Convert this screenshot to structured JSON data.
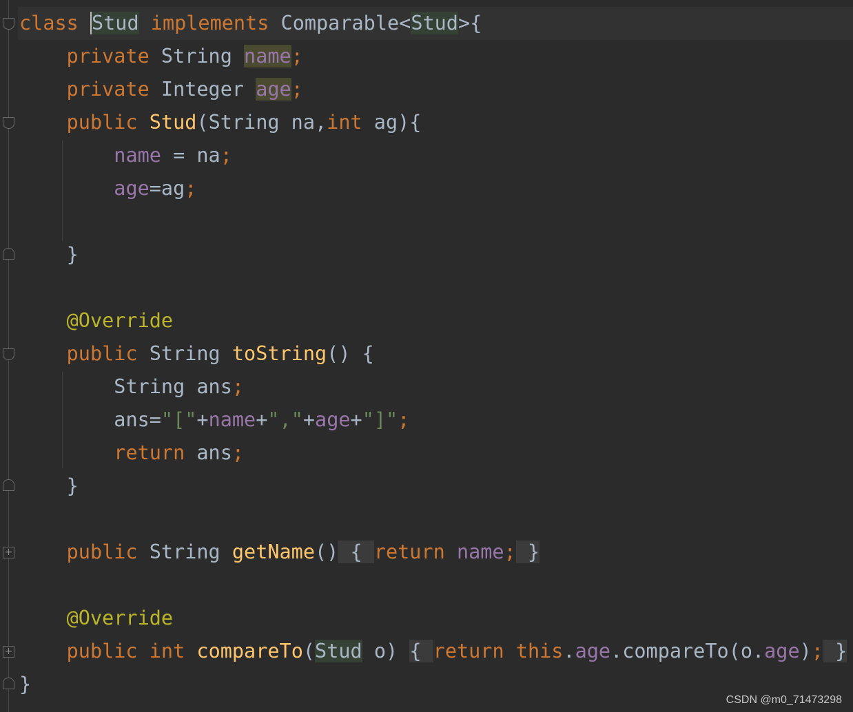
{
  "code": {
    "l1": {
      "kw_class": "class",
      "name": "Stud",
      "kw_implements": "implements",
      "iface": "Comparable",
      "lt": "<",
      "generic": "Stud",
      "gt_brace": ">{"
    },
    "l2": {
      "kw": "private",
      "type": "String",
      "field": "name",
      "semi": ";"
    },
    "l3": {
      "kw": "private",
      "type": "Integer",
      "field": "age",
      "semi": ";"
    },
    "l4": {
      "kw": "public",
      "ctor": "Stud",
      "open": "(String na,",
      "kw_int": "int",
      "rest": " ag){"
    },
    "l5": {
      "field": "name",
      "rest": " = na",
      "semi": ";"
    },
    "l6": {
      "field": "age",
      "rest": "=ag",
      "semi": ";"
    },
    "l8": {
      "text": "}"
    },
    "l10": {
      "annotation": "@Override"
    },
    "l11": {
      "kw": "public",
      "type": "String",
      "fn": "toString",
      "rest": "() {"
    },
    "l12": {
      "type": "String",
      "rest": " ans",
      "semi": ";"
    },
    "l13": {
      "pre": "ans=",
      "s1": "\"[\"",
      "plus1": "+",
      "f1": "name",
      "plus2": "+",
      "s2": "\",\"",
      "plus3": "+",
      "f2": "age",
      "plus4": "+",
      "s3": "\"]\"",
      "semi": ";"
    },
    "l14": {
      "kw": "return",
      "rest": " ans",
      "semi": ";"
    },
    "l15": {
      "text": "}"
    },
    "l17": {
      "kw": "public",
      "type": "String",
      "fn": "getName",
      "paren": "()",
      "fold_open": "{ ",
      "kw_return": "return",
      "field": "name",
      "semi": ";",
      "fold_close": " }"
    },
    "l19": {
      "annotation": "@Override"
    },
    "l20": {
      "kw": "public",
      "kw_int": "int",
      "fn": "compareTo",
      "open": "(",
      "ptype": "Stud",
      "pname": " o)",
      "fold_open": "{ ",
      "kw_return": "return",
      "kw_this": "this",
      "dot1": ".",
      "f1": "age",
      "call": ".compareTo(o.",
      "f2": "age",
      "close": ")",
      "semi": ";",
      "fold_close": " }"
    },
    "l21": {
      "text": "}"
    }
  },
  "watermark": "CSDN @m0_71473298",
  "colors": {
    "background": "#2b2b2b",
    "keyword": "#cc7832",
    "field": "#9876aa",
    "method": "#ffc66d",
    "string": "#6a8759",
    "annotation": "#bbb529",
    "plain": "#a9b7c6"
  }
}
